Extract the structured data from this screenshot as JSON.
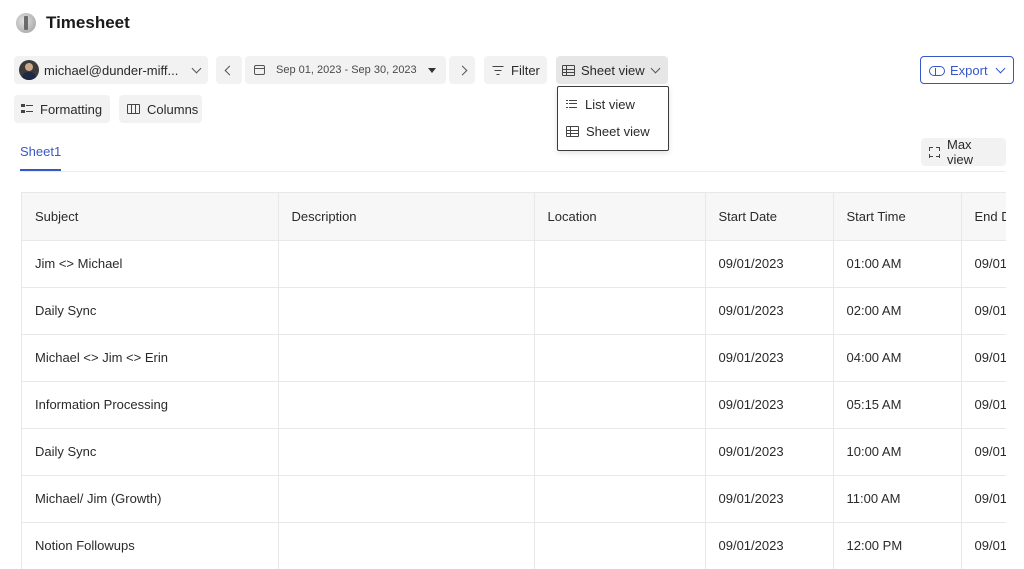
{
  "header": {
    "title": "Timesheet"
  },
  "toolbar": {
    "user_label": "michael@dunder-miff...",
    "date_range": "Sep 01, 2023 - Sep 30, 2023",
    "filter_label": "Filter",
    "view_label": "Sheet view",
    "export_label": "Export",
    "formatting_label": "Formatting",
    "columns_label": "Columns",
    "accent_color": "#3757c9"
  },
  "view_menu": {
    "items": [
      {
        "label": "List view",
        "icon": "list-icon"
      },
      {
        "label": "Sheet view",
        "icon": "grid-icon"
      }
    ]
  },
  "tabs": [
    {
      "label": "Sheet1",
      "active": true
    }
  ],
  "max_view_label": "Max view",
  "table": {
    "columns": [
      "Subject",
      "Description",
      "Location",
      "Start Date",
      "Start Time",
      "End D"
    ],
    "rows": [
      [
        "Jim <> Michael",
        "",
        "",
        "09/01/2023",
        "01:00 AM",
        "09/01"
      ],
      [
        "Daily Sync",
        "",
        "",
        "09/01/2023",
        "02:00 AM",
        "09/01"
      ],
      [
        "Michael <> Jim <> Erin",
        "",
        "",
        "09/01/2023",
        "04:00 AM",
        "09/01"
      ],
      [
        "Information Processing",
        "",
        "",
        "09/01/2023",
        "05:15 AM",
        "09/01"
      ],
      [
        "Daily Sync",
        "",
        "",
        "09/01/2023",
        "10:00 AM",
        "09/01"
      ],
      [
        "Michael/ Jim (Growth)",
        "",
        "",
        "09/01/2023",
        "11:00 AM",
        "09/01"
      ],
      [
        "Notion Followups",
        "",
        "",
        "09/01/2023",
        "12:00 PM",
        "09/01"
      ]
    ]
  }
}
